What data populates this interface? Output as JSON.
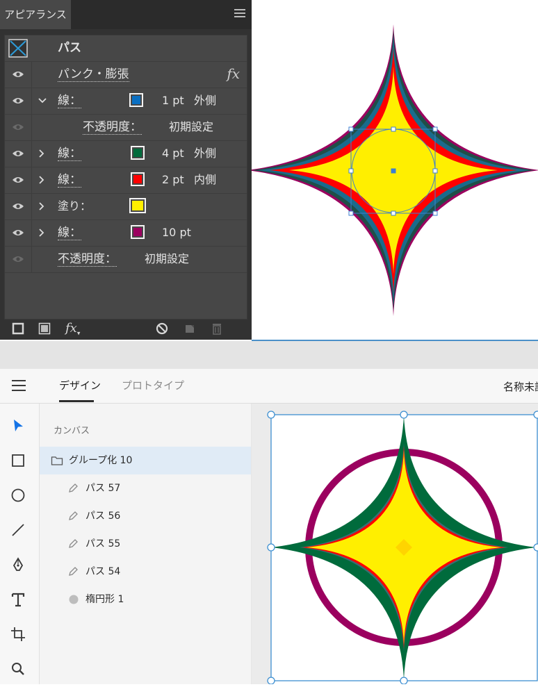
{
  "appearance_panel": {
    "tab_title": "アピアランス",
    "object_type": "パス",
    "rows": [
      {
        "id": "effect",
        "label": "パンク・膨張"
      },
      {
        "id": "stroke1",
        "label": "線：",
        "swatch": "#0a6fc2",
        "weight": "1 pt",
        "position": "外側"
      },
      {
        "id": "opacity_sub",
        "label": "不透明度：",
        "value": "初期設定"
      },
      {
        "id": "stroke2",
        "label": "線：",
        "swatch": "#006b3c",
        "weight": "4 pt",
        "position": "外側"
      },
      {
        "id": "stroke3",
        "label": "線：",
        "swatch": "#ff0000",
        "weight": "2 pt",
        "position": "内側"
      },
      {
        "id": "fill",
        "label": "塗り：",
        "swatch": "#ffef00"
      },
      {
        "id": "stroke4",
        "label": "線：",
        "swatch": "#9b005f",
        "weight": "10 pt"
      },
      {
        "id": "opacity",
        "label": "不透明度：",
        "value": "初期設定"
      }
    ]
  },
  "xd": {
    "tabs": {
      "design": "デザイン",
      "prototype": "プロトタイプ"
    },
    "doc_name": "名称未設定",
    "layers_title": "カンバス",
    "layers": [
      {
        "label": "グループ化 10"
      },
      {
        "label": "パス 57"
      },
      {
        "label": "パス 56"
      },
      {
        "label": "パス 55"
      },
      {
        "label": "パス 54"
      },
      {
        "label": "楕円形 1"
      }
    ],
    "colors": {
      "ring": "#9b005f",
      "outer_stroke": "#006b3c",
      "inner_stroke": "#ff0000",
      "fill": "#ffef00",
      "selection": "#3d8fd1"
    }
  }
}
